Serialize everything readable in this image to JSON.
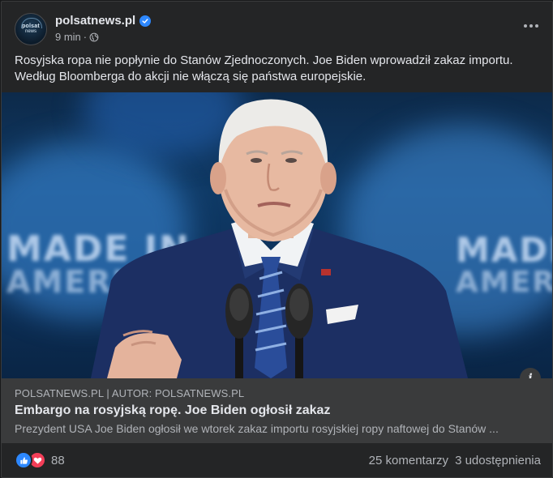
{
  "post": {
    "page_name": "polsatnews.pl",
    "avatar_text_top": "polsat",
    "avatar_text_bottom": "news",
    "time": "9 min",
    "separator": "·",
    "text": "Rosyjska ropa nie popłynie do Stanów Zjednoczonych. Joe Biden wprowadził zakaz importu. Według Bloomberga do akcji nie włączą się państwa europejskie.",
    "icons": [
      "verified-badge-icon",
      "globe-icon",
      "more-options-icon",
      "info-icon",
      "like-reaction-icon",
      "love-reaction-icon"
    ]
  },
  "image": {
    "background_text_left": "MADE IN",
    "background_text_left_2": "AMERICA",
    "background_text_right": "MADE",
    "background_text_right_2": "AMER"
  },
  "link": {
    "domain": "POLSATNEWS.PL | AUTOR: POLSATNEWS.PL",
    "headline": "Embargo na rosyjską ropę. Joe Biden ogłosił zakaz",
    "description": "Prezydent USA Joe Biden ogłosił we wtorek zakaz importu rosyjskiej ropy naftowej do Stanów ..."
  },
  "footer": {
    "reaction_count": "88",
    "comments": "25 komentarzy",
    "shares": "3 udostępnienia"
  },
  "colors": {
    "card_bg": "#242526",
    "link_box_bg": "#3a3b3c",
    "accent_blue": "#2d88ff",
    "love_red": "#f33e58",
    "text_primary": "#e4e6eb",
    "text_secondary": "#b0b3b8"
  }
}
